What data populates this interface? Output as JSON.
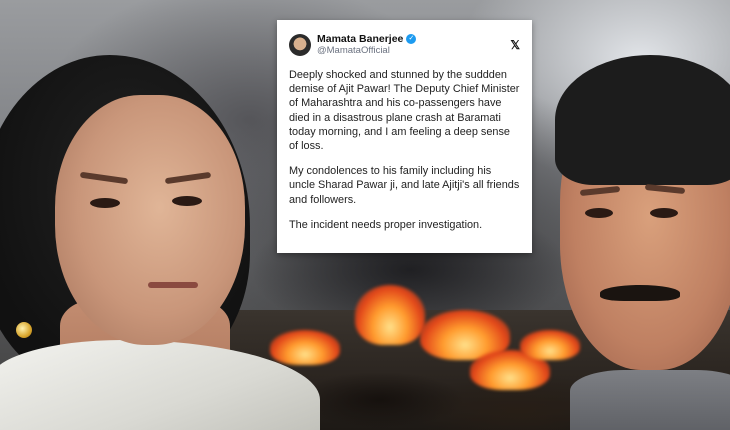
{
  "tweet": {
    "display_name": "Mamata Banerjee",
    "handle": "@MamataOfficial",
    "verified_badge": "✓",
    "platform_icon": "x-logo-icon",
    "platform_glyph": "𝕏",
    "paragraphs": [
      "Deeply shocked and stunned by the suddden demise of Ajit Pawar! The Deputy Chief Minister of Maharashtra and his co-passengers have died in a disastrous plane crash at Baramati today morning, and I am feeling a deep sense of loss.",
      "My condolences to his family including his uncle Sharad Pawar ji, and late Ajitji's all friends and followers.",
      "The incident needs proper investigation."
    ]
  },
  "colors": {
    "verified": "#1d9bf0",
    "fire": "#ff9b2e",
    "card_background": "#ffffff"
  }
}
